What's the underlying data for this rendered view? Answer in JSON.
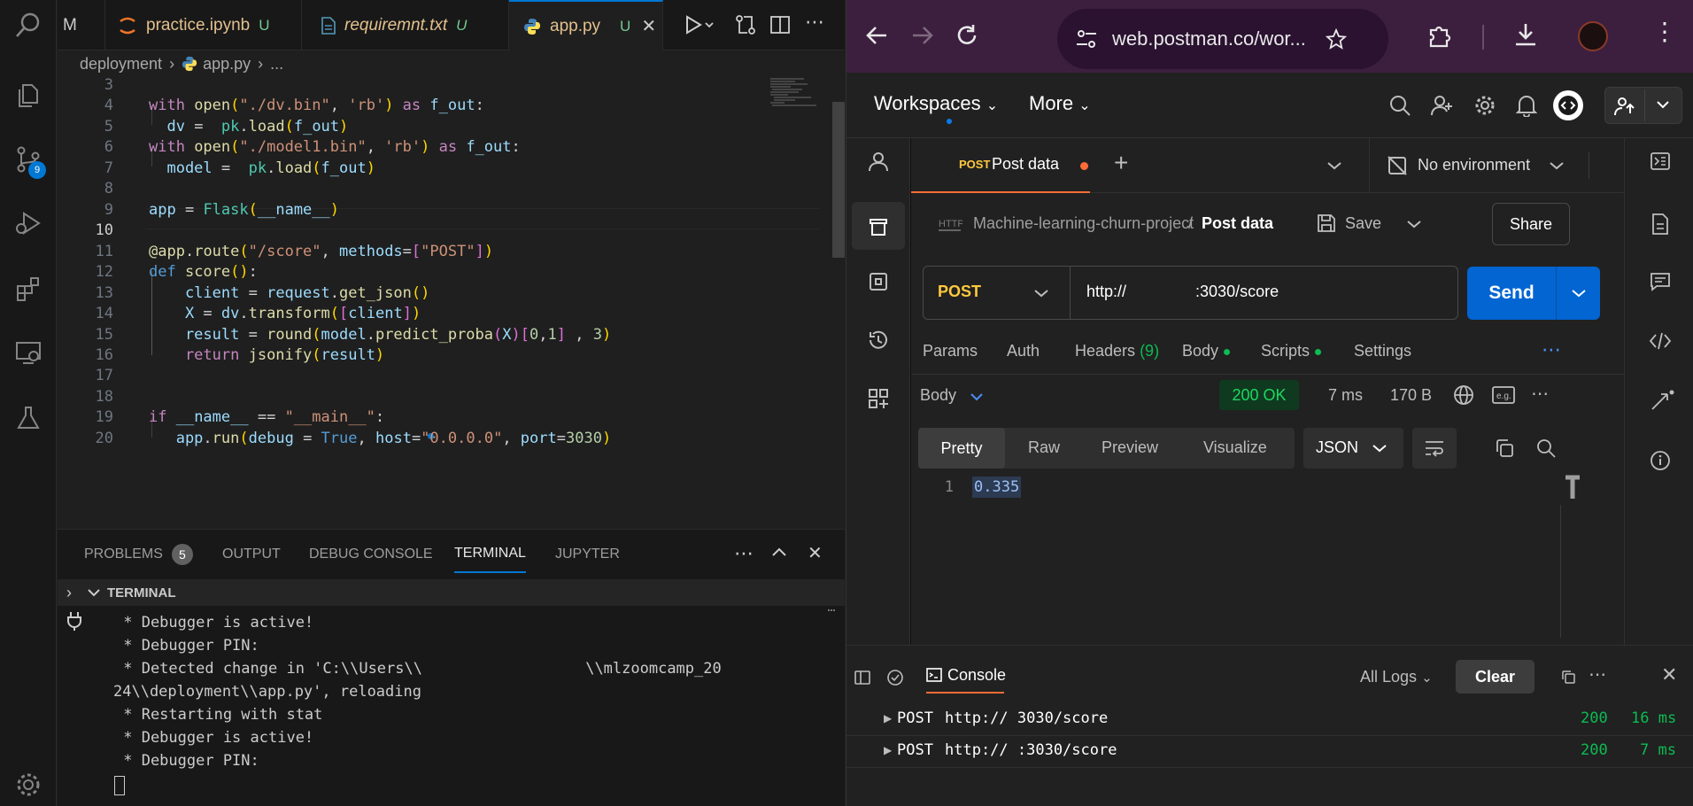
{
  "vscode": {
    "tabs": [
      {
        "label": "M"
      },
      {
        "label": "practice.ipynb",
        "status": "U"
      },
      {
        "label": "requiremnt.txt",
        "status": "U"
      },
      {
        "label": "app.py",
        "status": "U"
      }
    ],
    "breadcrumb": {
      "folder": "deployment",
      "file": "app.py",
      "more": "..."
    },
    "activity_badge": "9",
    "line_numbers": [
      "3",
      "4",
      "5",
      "6",
      "7",
      "8",
      "9",
      "10",
      "11",
      "12",
      "13",
      "14",
      "15",
      "16",
      "17",
      "18",
      "19",
      "20"
    ],
    "code": {
      "l4": {
        "a": "with",
        "b": " open",
        "c": "(",
        "d": "\"./dv.bin\"",
        "e": ", ",
        "f": "'rb'",
        "g": ")",
        "h": " as ",
        "i": "f_out",
        "j": ":"
      },
      "l5": {
        "a": "  dv",
        "b": " =  ",
        "c": "pk",
        "d": ".",
        "e": "load",
        "f": "(",
        "g": "f_out",
        "h": ")"
      },
      "l6": {
        "a": "with",
        "b": " open",
        "c": "(",
        "d": "\"./model1.bin\"",
        "e": ", ",
        "f": "'rb'",
        "g": ")",
        "h": " as ",
        "i": "f_out",
        "j": ":"
      },
      "l7": {
        "a": "  model",
        "b": " =  ",
        "c": "pk",
        "d": ".",
        "e": "load",
        "f": "(",
        "g": "f_out",
        "h": ")"
      },
      "l9": {
        "a": "app",
        "b": " = ",
        "c": "Flask",
        "d": "(",
        "e": "__name__",
        "f": ")"
      },
      "l11": {
        "a": "@app",
        "b": ".",
        "c": "route",
        "d": "(",
        "e": "\"/score\"",
        "f": ", ",
        "g": "methods",
        "h": "=",
        "i": "[",
        "j": "\"POST\"",
        "k": "]",
        "l": ")"
      },
      "l12": {
        "a": "def",
        "b": " score",
        "c": "()",
        "d": ":"
      },
      "l13": {
        "a": "    client",
        "b": " = ",
        "c": "request",
        "d": ".",
        "e": "get_json",
        "f": "()"
      },
      "l14": {
        "a": "    X",
        "b": " = ",
        "c": "dv",
        "d": ".",
        "e": "transform",
        "f": "(",
        "g": "[",
        "h": "client",
        "i": "]",
        "j": ")"
      },
      "l15": {
        "a": "    result",
        "b": " = ",
        "c": "round",
        "d": "(",
        "e": "model",
        "f": ".",
        "g": "predict_proba",
        "h": "(",
        "i": "X",
        "j": ")",
        "k": "[",
        "l": "0",
        "m": ",",
        "n": "1",
        "o": "]",
        "p": " , ",
        "q": "3",
        "r": ")"
      },
      "l16": {
        "a": "    return",
        "b": " jsonify",
        "c": "(",
        "d": "result",
        "e": ")"
      },
      "l19": {
        "a": "if",
        "b": " __name__",
        "c": " == ",
        "d": "\"__main__\"",
        "e": ":"
      },
      "l20": {
        "a": "   app",
        "b": ".",
        "c": "run",
        "d": "(",
        "e": "debug",
        "f": " = ",
        "g": "True",
        "h": ", ",
        "i": "host",
        "j": "=",
        "k": "\"0.0.0.0\"",
        "l": ", ",
        "m": "port",
        "n": "=",
        "o": "3030",
        "p": ")"
      }
    },
    "panel": {
      "tabs": [
        "PROBLEMS",
        "OUTPUT",
        "DEBUG CONSOLE",
        "TERMINAL",
        "JUPYTER"
      ],
      "problems_count": "5",
      "section": "TERMINAL",
      "terminal_lines": [
        " * Debugger is active!",
        " * Debugger PIN: ",
        " * Detected change in 'C:\\\\Users\\\\                  \\\\mlzoomcamp_20",
        "24\\\\deployment\\\\app.py', reloading",
        " * Restarting with stat",
        " * Debugger is active!",
        " * Debugger PIN: "
      ]
    }
  },
  "browser": {
    "url": "web.postman.co/wor...",
    "postman": {
      "workspaces": "Workspaces",
      "more": "More",
      "tab_method": "POST",
      "tab_title": "Post data",
      "environment": "No environment",
      "crumb_collection": "Machine-learning-churn-project",
      "crumb_sep": "/",
      "crumb_request": "Post data",
      "save": "Save",
      "share": "Share",
      "method": "POST",
      "url_prefix": "http://",
      "url_suffix": ":3030/score",
      "send": "Send",
      "req_tabs": {
        "params": "Params",
        "auth": "Auth",
        "headers": "Headers",
        "headers_count": "(9)",
        "body": "Body",
        "scripts": "Scripts",
        "settings": "Settings"
      },
      "response": {
        "label": "Body",
        "status": "200 OK",
        "time": "7 ms",
        "size": "170 B",
        "views": [
          "Pretty",
          "Raw",
          "Preview",
          "Visualize"
        ],
        "format": "JSON",
        "line": "1",
        "value": "0.335"
      },
      "console": {
        "title": "Console",
        "filter": "All Logs",
        "clear": "Clear",
        "entries": [
          {
            "method": "POST",
            "url": "http://  3030/score",
            "status": "200",
            "time": "16 ms"
          },
          {
            "method": "POST",
            "url": "http://  :3030/score",
            "status": "200",
            "time": "7 ms"
          }
        ]
      }
    }
  },
  "colors": {
    "accent_blue": "#0078d4",
    "postman_send": "#0265d2",
    "status_ok": "#0cbb52",
    "postman_orange": "#ff6c37"
  }
}
